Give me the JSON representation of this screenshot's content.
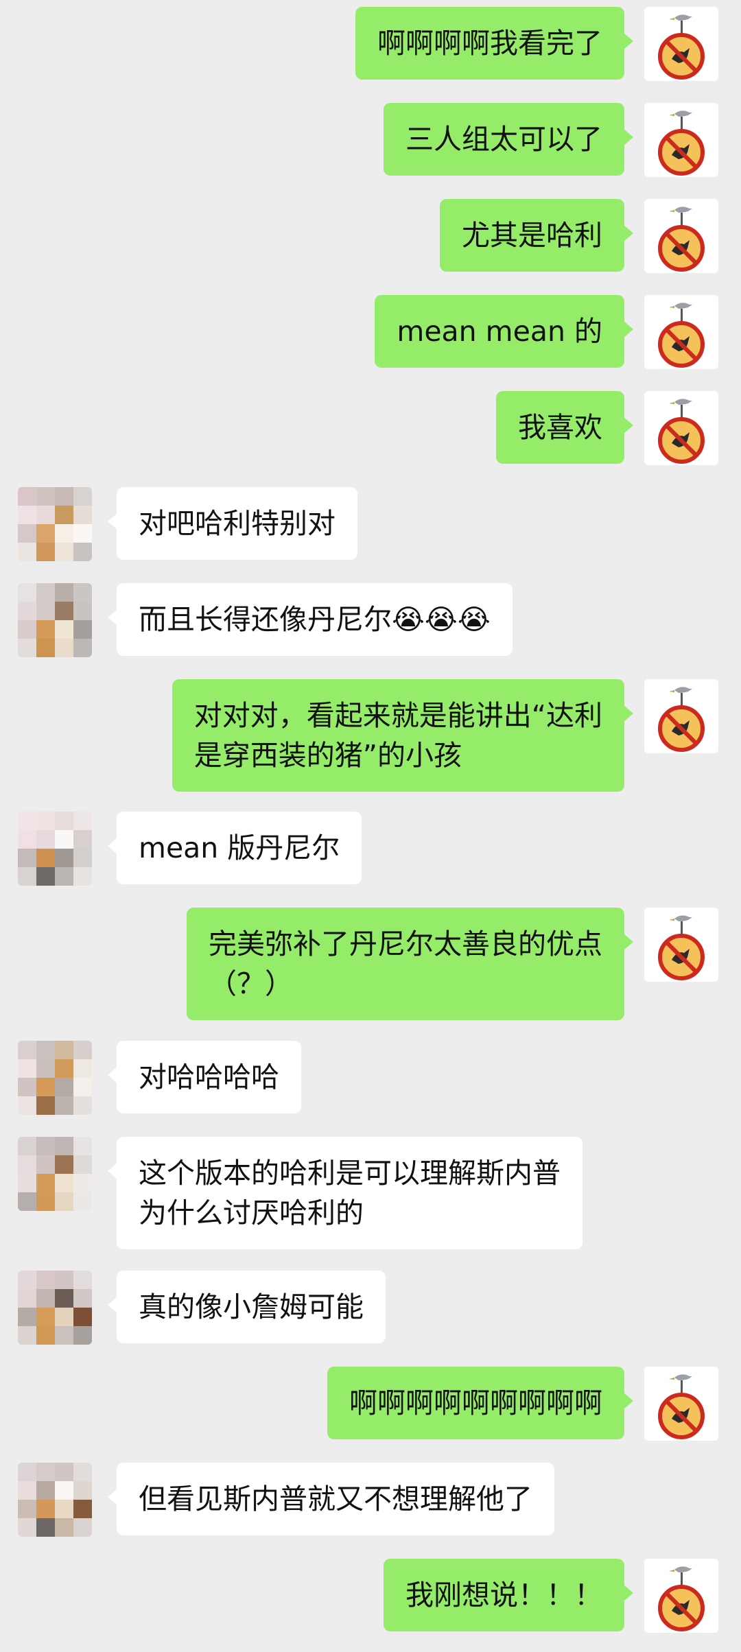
{
  "colors": {
    "background": "#ededed",
    "self_bubble": "#95ec69",
    "other_bubble": "#ffffff",
    "sign_red": "#cc2a1e",
    "sign_fill": "#f4c15a"
  },
  "icons": {
    "self_avatar": "no-seagull-sign-icon",
    "other_avatar": "pixelated-avatar",
    "laugh_emoji": "rolling-laughing-emoji"
  },
  "messages": [
    {
      "sender": "self",
      "text": "啊啊啊啊我看完了"
    },
    {
      "sender": "self",
      "text": "三人组太可以了"
    },
    {
      "sender": "self",
      "text": "尤其是哈利"
    },
    {
      "sender": "self",
      "text": "mean mean 的"
    },
    {
      "sender": "self",
      "text": "我喜欢"
    },
    {
      "sender": "other",
      "text": "对吧哈利特别对"
    },
    {
      "sender": "other",
      "text": "而且长得还像丹尼尔😭😭😭"
    },
    {
      "sender": "self",
      "text": "对对对，看起来就是能讲出“达利\n是穿西装的猪”的小孩"
    },
    {
      "sender": "other",
      "text": "mean 版丹尼尔"
    },
    {
      "sender": "self",
      "text": "完美弥补了丹尼尔太善良的优点\n（？）"
    },
    {
      "sender": "other",
      "text": "对哈哈哈哈"
    },
    {
      "sender": "other",
      "text": "这个版本的哈利是可以理解斯内普\n为什么讨厌哈利的"
    },
    {
      "sender": "other",
      "text": "真的像小詹姆可能"
    },
    {
      "sender": "self",
      "text": "啊啊啊啊啊啊啊啊啊"
    },
    {
      "sender": "other",
      "text": "但看见斯内普就又不想理解他了"
    },
    {
      "sender": "self",
      "text": "我刚想说！！！"
    }
  ]
}
